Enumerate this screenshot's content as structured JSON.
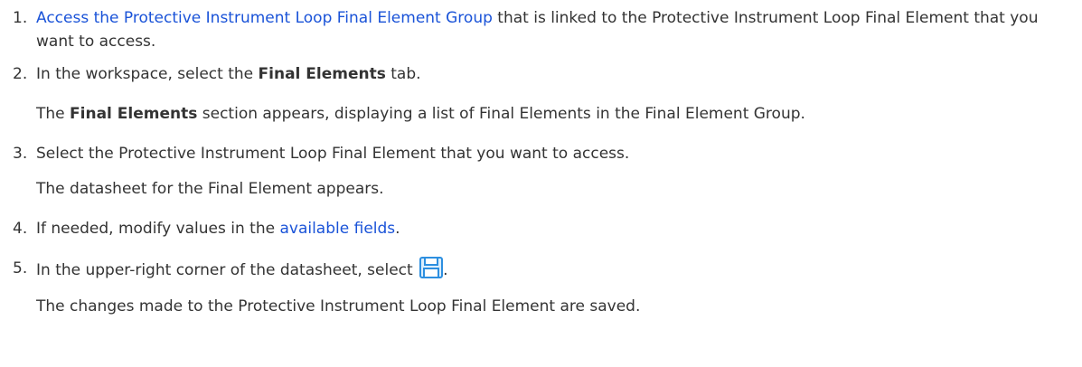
{
  "steps": [
    {
      "number": "1.",
      "link_text": "Access the Protective Instrument Loop Final Element Group",
      "text_after_link": " that is linked to the Protective Instrument Loop Final Element that you want to access."
    },
    {
      "number": "2.",
      "text_before": "In the workspace, select the ",
      "bold": "Final Elements",
      "text_after": " tab.",
      "result_bold": "Final Elements",
      "result_after": " section appears, displaying a list of Final Elements in the Final Element Group.",
      "result_before": "The "
    },
    {
      "number": "3.",
      "text": "Select the Protective Instrument Loop Final Element that you want to access.",
      "result": "The datasheet for the Final Element appears."
    },
    {
      "number": "4.",
      "text_before": "If needed, modify values in the ",
      "link_text": "available fields",
      "text_after": "."
    },
    {
      "number": "5.",
      "text_before": "In the upper-right corner of the datasheet, select ",
      "icon": "save-icon",
      "text_after": ".",
      "result": "The changes made to the Protective Instrument Loop Final Element are saved."
    }
  ],
  "colors": {
    "link": "#1a53d8",
    "text": "#333333",
    "icon_blue": "#2d8fe0"
  }
}
